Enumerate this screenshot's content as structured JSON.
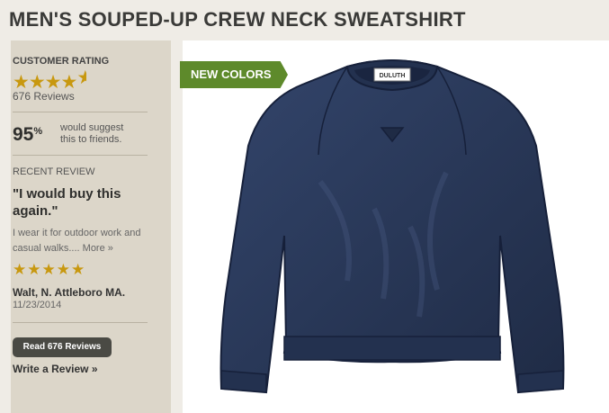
{
  "product": {
    "title": "MEN'S SOUPED-UP CREW NECK SWEATSHIRT",
    "badge": "NEW COLORS",
    "label_text": "DULUTH"
  },
  "rating": {
    "heading": "CUSTOMER RATING",
    "stars": 4.5,
    "count_label": "676 Reviews"
  },
  "suggest": {
    "percent": "95",
    "percent_sign": "%",
    "text": "would suggest this to friends."
  },
  "recent_review": {
    "heading": "RECENT REVIEW",
    "quote": "\"I would buy this again.\"",
    "body": "I wear it for outdoor work and casual walks....",
    "more_label": "More »",
    "stars": 5,
    "reviewer": "Walt, N. Attleboro MA.",
    "date": "11/23/2014"
  },
  "actions": {
    "read_label": "Read 676 Reviews",
    "write_label": "Write a Review »"
  },
  "colors": {
    "badge_green": "#5e8a2b",
    "star_gold": "#c8980f",
    "sweater_navy": "#2b3a5c",
    "sidebar_bg": "#dcd6c9"
  }
}
